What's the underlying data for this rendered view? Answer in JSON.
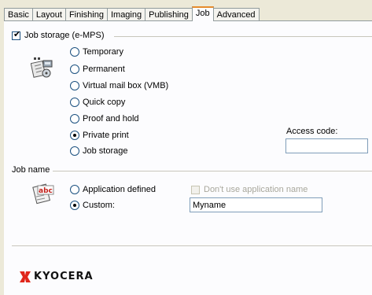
{
  "tabs": [
    {
      "label": "Basic"
    },
    {
      "label": "Layout"
    },
    {
      "label": "Finishing"
    },
    {
      "label": "Imaging"
    },
    {
      "label": "Publishing"
    },
    {
      "label": "Job",
      "active": true
    },
    {
      "label": "Advanced"
    }
  ],
  "job_storage": {
    "label": "Job storage (e-MPS)",
    "checked": true,
    "icon": "job-storage-icon",
    "options": [
      {
        "label": "Temporary",
        "selected": false
      },
      {
        "label": "Permanent",
        "selected": false
      },
      {
        "label": "Virtual mail box (VMB)",
        "selected": false
      },
      {
        "label": "Quick copy",
        "selected": false
      },
      {
        "label": "Proof and hold",
        "selected": false
      },
      {
        "label": "Private print",
        "selected": true
      },
      {
        "label": "Job storage",
        "selected": false
      }
    ],
    "access_code": {
      "label": "Access code:",
      "value": ""
    }
  },
  "job_name": {
    "label": "Job name",
    "icon": "abc-document-icon",
    "options": [
      {
        "label": "Application defined",
        "selected": false
      },
      {
        "label": "Custom:",
        "selected": true
      }
    ],
    "dont_use_app_name": {
      "label": "Don't use application name",
      "checked": false,
      "enabled": false
    },
    "custom_value": "Myname"
  },
  "brand": {
    "name": "KYOCERA",
    "color": "#e0261b"
  }
}
